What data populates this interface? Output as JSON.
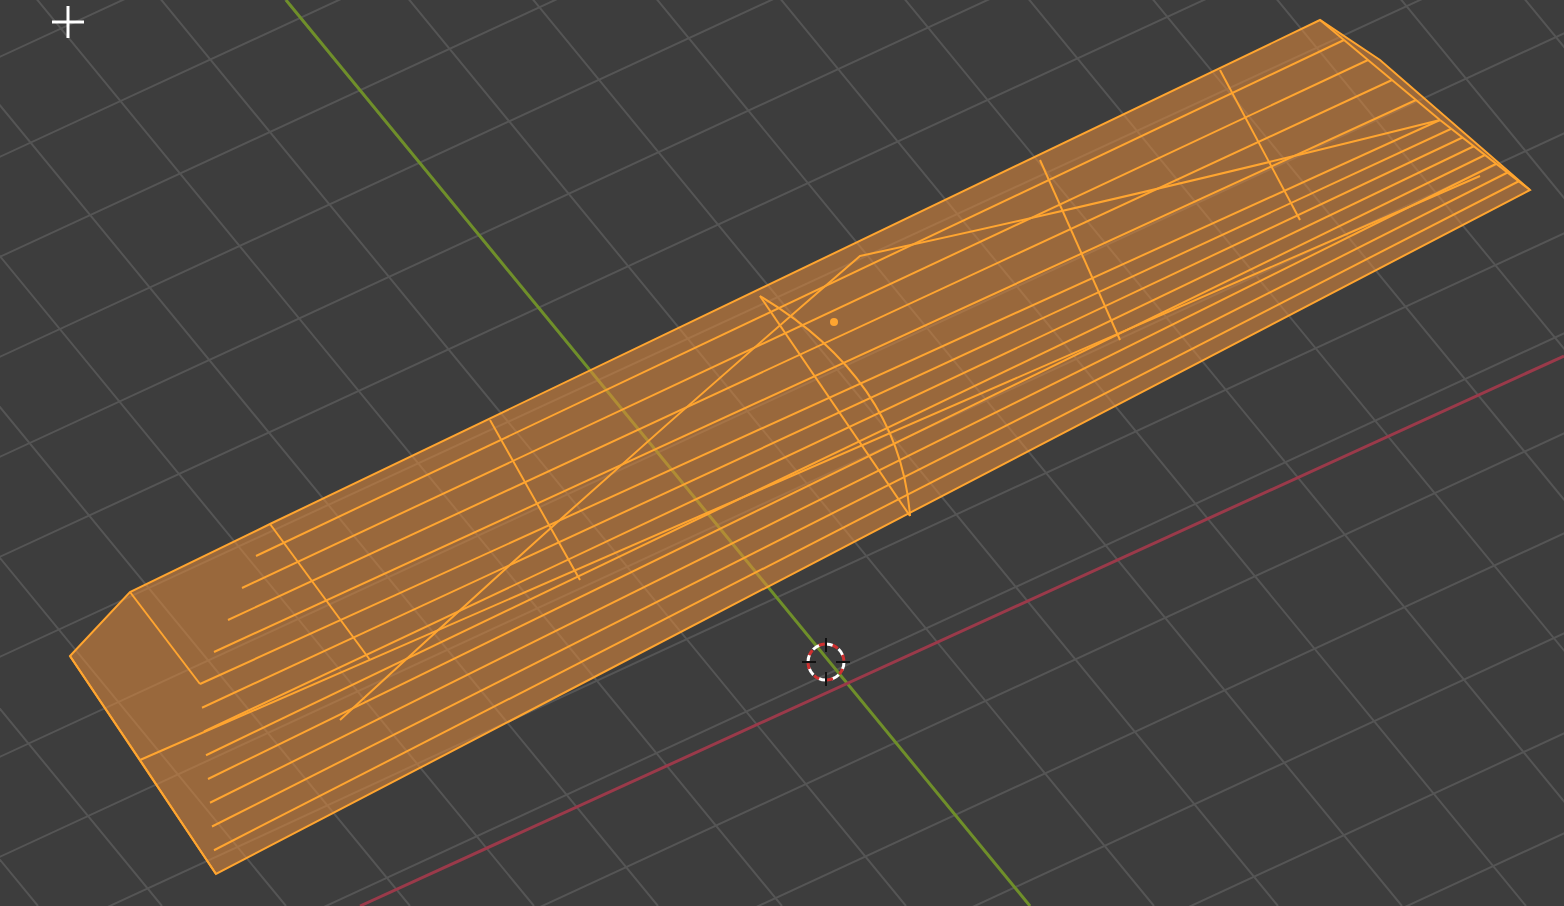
{
  "viewport": {
    "kind": "perspective"
  },
  "mesh": {
    "selected": true
  }
}
